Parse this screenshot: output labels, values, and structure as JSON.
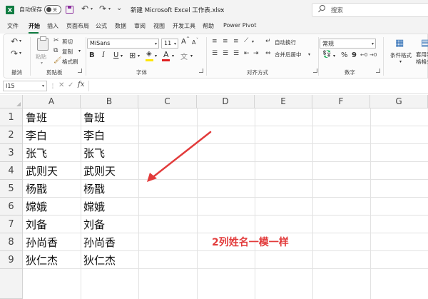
{
  "titlebar": {
    "autosave_label": "自动保存",
    "autosave_state": "关",
    "document_title": "新建 Microsoft Excel 工作表.xlsx",
    "search_label": "搜索"
  },
  "tabs": [
    "文件",
    "开始",
    "插入",
    "页面布局",
    "公式",
    "数据",
    "审阅",
    "视图",
    "开发工具",
    "帮助",
    "Power Pivot"
  ],
  "active_tab": "开始",
  "ribbon": {
    "undo_group": "撤消",
    "clipboard": {
      "paste": "粘贴",
      "cut": "剪切",
      "copy": "复制",
      "format_painter": "格式刷",
      "label": "剪贴板"
    },
    "font": {
      "name": "MiSans",
      "size": "11",
      "bold": "B",
      "italic": "I",
      "underline": "U",
      "grow": "A",
      "shrink": "A",
      "label": "字体"
    },
    "alignment": {
      "wrap": "自动换行",
      "merge": "合并后居中",
      "label": "对齐方式"
    },
    "number": {
      "format": "常规",
      "percent": "%",
      "comma": "9",
      "label": "数字"
    },
    "styles": {
      "conditional": "条件格式",
      "table_format": "套用表格格式"
    }
  },
  "formula_bar": {
    "name_box": "I15",
    "fx": "fx",
    "value": ""
  },
  "columns": [
    "A",
    "B",
    "C",
    "D",
    "E",
    "F",
    "G"
  ],
  "rows": [
    "1",
    "2",
    "3",
    "4",
    "5",
    "6",
    "7",
    "8",
    "9"
  ],
  "cells": {
    "A": [
      "鲁班",
      "李白",
      "张飞",
      "武则天",
      "杨戬",
      "嫦娥",
      "刘备",
      "孙尚香",
      "狄仁杰"
    ],
    "B": [
      "鲁班",
      "李白",
      "张飞",
      "武则天",
      "杨戬",
      "嫦娥",
      "刘备",
      "孙尚香",
      "狄仁杰"
    ]
  },
  "annotation": "2列姓名一模一样",
  "colors": {
    "excel_green": "#107c41",
    "annotation_red": "#e23b3b",
    "font_color": "#e02020",
    "highlight": "#ffe600"
  }
}
